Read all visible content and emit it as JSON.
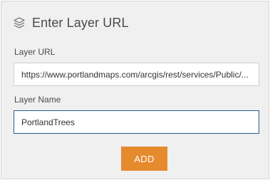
{
  "header": {
    "title": "Enter Layer URL",
    "icon": "layers-icon"
  },
  "form": {
    "url_label": "Layer URL",
    "url_value": "https://www.portlandmaps.com/arcgis/rest/services/Public/...",
    "name_label": "Layer Name",
    "name_value": "PortlandTrees"
  },
  "actions": {
    "add_label": "ADD"
  },
  "colors": {
    "accent": "#e68a2e",
    "focus_border": "#2a5b8a",
    "panel_bg": "#f0f0f0"
  }
}
